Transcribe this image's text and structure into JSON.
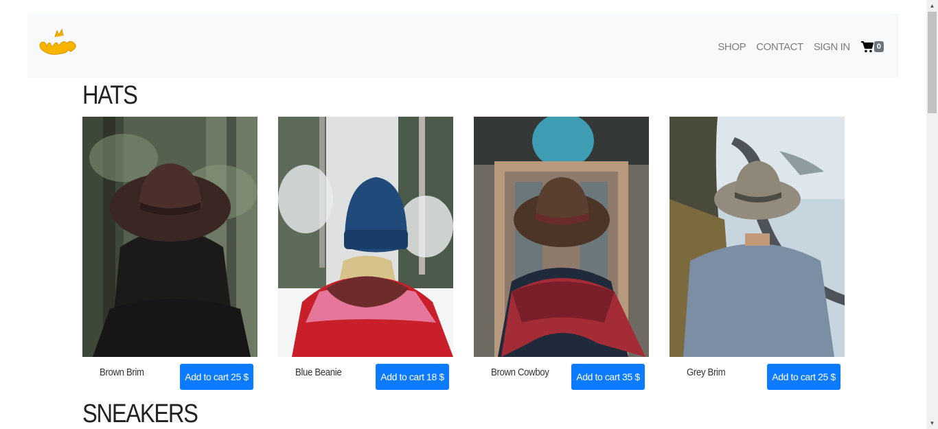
{
  "brand": {
    "logo_text": "King"
  },
  "nav": {
    "items": [
      "SHOP",
      "CONTACT",
      "SIGN IN"
    ],
    "cart_count": "0"
  },
  "sections": [
    {
      "title": "HATS",
      "products": [
        {
          "name": "Brown Brim",
          "button": "Add to cart 25 $",
          "scene": "forest, long dark hair, brown fedora"
        },
        {
          "name": "Blue Beanie",
          "button": "Add to cart 18 $",
          "scene": "snowy woods, blue knit beanie, pink jacket"
        },
        {
          "name": "Brown Cowboy",
          "button": "Add to cart 35 $",
          "scene": "tiled building, brown cowboy hat, red scarf"
        },
        {
          "name": "Grey Brim",
          "button": "Add to cart 25 $",
          "scene": "coastal road, grey brim hat, blue sweater"
        }
      ]
    },
    {
      "title": "SNEAKERS"
    }
  ],
  "colors": {
    "accent": "#0d7bff",
    "navbar_bg": "#f8f9fa",
    "badge": "#6c757d",
    "logo": "#f7b500"
  }
}
